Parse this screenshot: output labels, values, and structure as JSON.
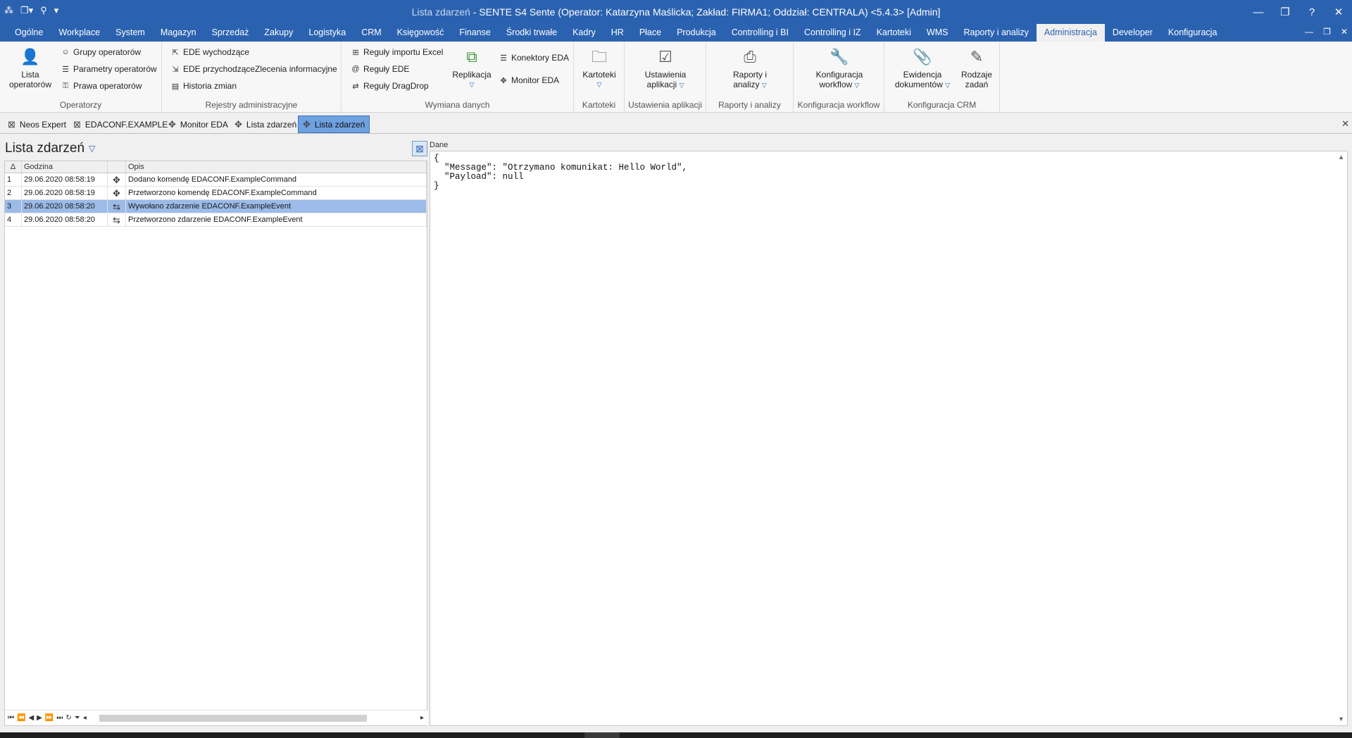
{
  "window": {
    "title_dim": "Lista zdarzeń",
    "title_main": " - SENTE S4 Sente (Operator: Katarzyna Maślicka; Zakład: FIRMA1; Oddział: CENTRALA) <5.4.3> [Admin]",
    "buttons": [
      "—",
      "❐",
      "?",
      "✕"
    ]
  },
  "menu": {
    "tabs": [
      "Ogólne",
      "Workplace",
      "System",
      "Magazyn",
      "Sprzedaż",
      "Zakupy",
      "Logistyka",
      "CRM",
      "Księgowość",
      "Finanse",
      "Środki trwałe",
      "Kadry",
      "HR",
      "Płace",
      "Produkcja",
      "Controlling i BI",
      "Controlling i IZ",
      "Kartoteki",
      "WMS",
      "Raporty i analizy",
      "Administracja",
      "Developer",
      "Konfiguracja"
    ],
    "active": "Administracja"
  },
  "ribbon": {
    "operatorzy": {
      "label": "Operatorzy",
      "lista": "Lista\noperatorów",
      "grupy": "Grupy operatorów",
      "parametry": "Parametry operatorów",
      "prawa": "Prawa operatorów"
    },
    "rejestry": {
      "label": "Rejestry administracyjne",
      "ede_wych": "EDE wychodzące",
      "ede_przych": "EDE przychodzące",
      "historia": "Historia zmian",
      "zlecenia": "Zlecenia informacyjne"
    },
    "wymiana": {
      "label": "Wymiana danych",
      "excel": "Reguły importu Excel",
      "ede": "Reguły EDE",
      "dragdrop": "Reguły DragDrop",
      "replikacja": "Replikacja",
      "konektory": "Konektory EDA",
      "monitor": "Monitor EDA"
    },
    "kartoteki": {
      "label": "Kartoteki",
      "btn": "Kartoteki"
    },
    "ustawienia": {
      "label": "Ustawienia aplikacji",
      "btn1": "Ustawienia",
      "btn2": "aplikacji"
    },
    "raporty": {
      "label": "Raporty i analizy",
      "btn1": "Raporty i",
      "btn2": "analizy"
    },
    "workflow": {
      "label": "Konfiguracja workflow",
      "btn1": "Konfiguracja",
      "btn2": "workflow"
    },
    "crm": {
      "label": "Konfiguracja CRM",
      "ewid1": "Ewidencja",
      "ewid2": "dokumentów",
      "rodz1": "Rodzaje",
      "rodz2": "zadań"
    }
  },
  "doc_tabs": [
    "Neos Expert",
    "EDACONF.EXAMPLE",
    "Monitor EDA",
    "Lista zdarzeń",
    "Lista zdarzeń"
  ],
  "left": {
    "title": "Lista zdarzeń",
    "columns": [
      "Δ",
      "Godzina",
      "",
      "Opis"
    ],
    "rows": [
      {
        "n": "1",
        "time": "29.06.2020 08:58:19",
        "desc": "Dodano komendę EDACONF.ExampleCommand"
      },
      {
        "n": "2",
        "time": "29.06.2020 08:58:19",
        "desc": "Przetworzono komendę EDACONF.ExampleCommand"
      },
      {
        "n": "3",
        "time": "29.06.2020 08:58:20",
        "desc": "Wywołano zdarzenie EDACONF.ExampleEvent"
      },
      {
        "n": "4",
        "time": "29.06.2020 08:58:20",
        "desc": "Przetworzono zdarzenie EDACONF.ExampleEvent"
      }
    ],
    "selected_row": "3"
  },
  "right": {
    "label": "Dane",
    "content": "{\n  \"Message\": \"Otrzymano komunikat: Hello World\",\n  \"Payload\": null\n}"
  }
}
